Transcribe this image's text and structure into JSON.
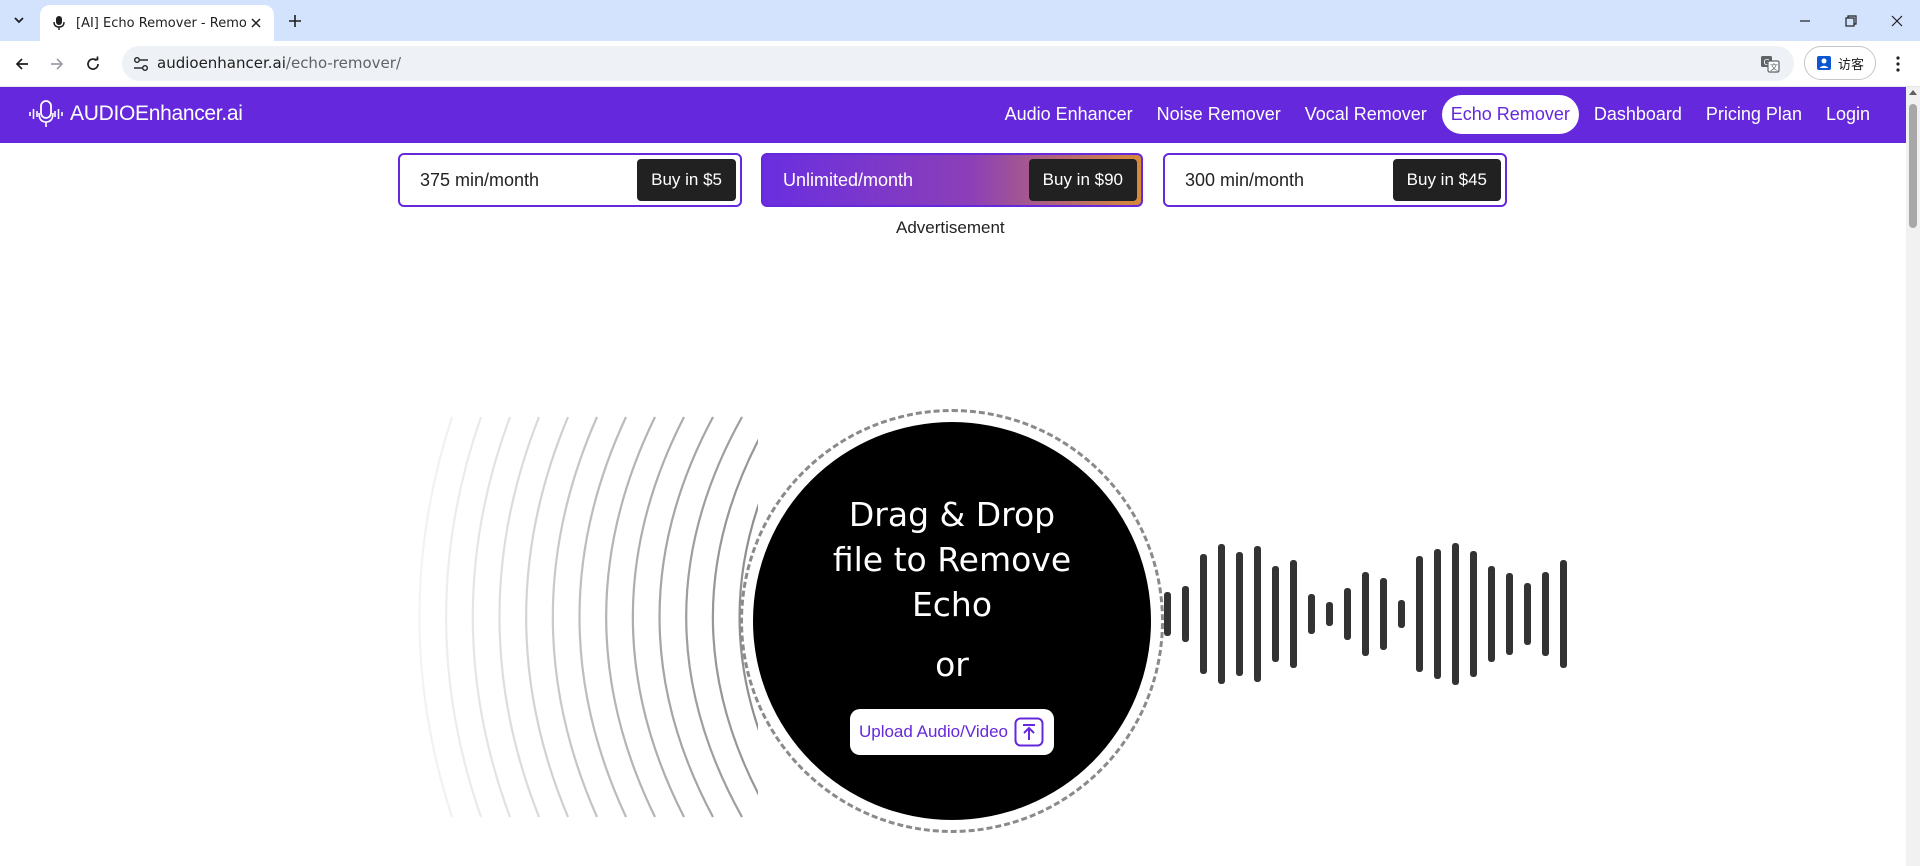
{
  "browser": {
    "tab_title": "[AI] Echo Remover - Remove",
    "url_domain": "audioenhancer.ai",
    "url_path": "/echo-remover/",
    "profile_label": "访客"
  },
  "site": {
    "logo_text": "AUDIOEnhancer.ai",
    "menu": [
      {
        "label": "Audio Enhancer"
      },
      {
        "label": "Noise Remover"
      },
      {
        "label": "Vocal Remover"
      },
      {
        "label": "Echo Remover"
      },
      {
        "label": "Dashboard"
      },
      {
        "label": "Pricing Plan"
      },
      {
        "label": "Login"
      }
    ],
    "active_menu": "Echo Remover"
  },
  "plans": [
    {
      "label": "375 min/month",
      "buy": "Buy in $5"
    },
    {
      "label": "Unlimited/month",
      "buy": "Buy in $90"
    },
    {
      "label": "300 min/month",
      "buy": "Buy in $45"
    }
  ],
  "ad_label": "Advertisement",
  "dropzone": {
    "title": "Drag & Drop file to Remove Echo",
    "or": "or",
    "upload_label": "Upload Audio/Video"
  },
  "colors": {
    "brand": "#6528dc",
    "dark": "#212121"
  }
}
